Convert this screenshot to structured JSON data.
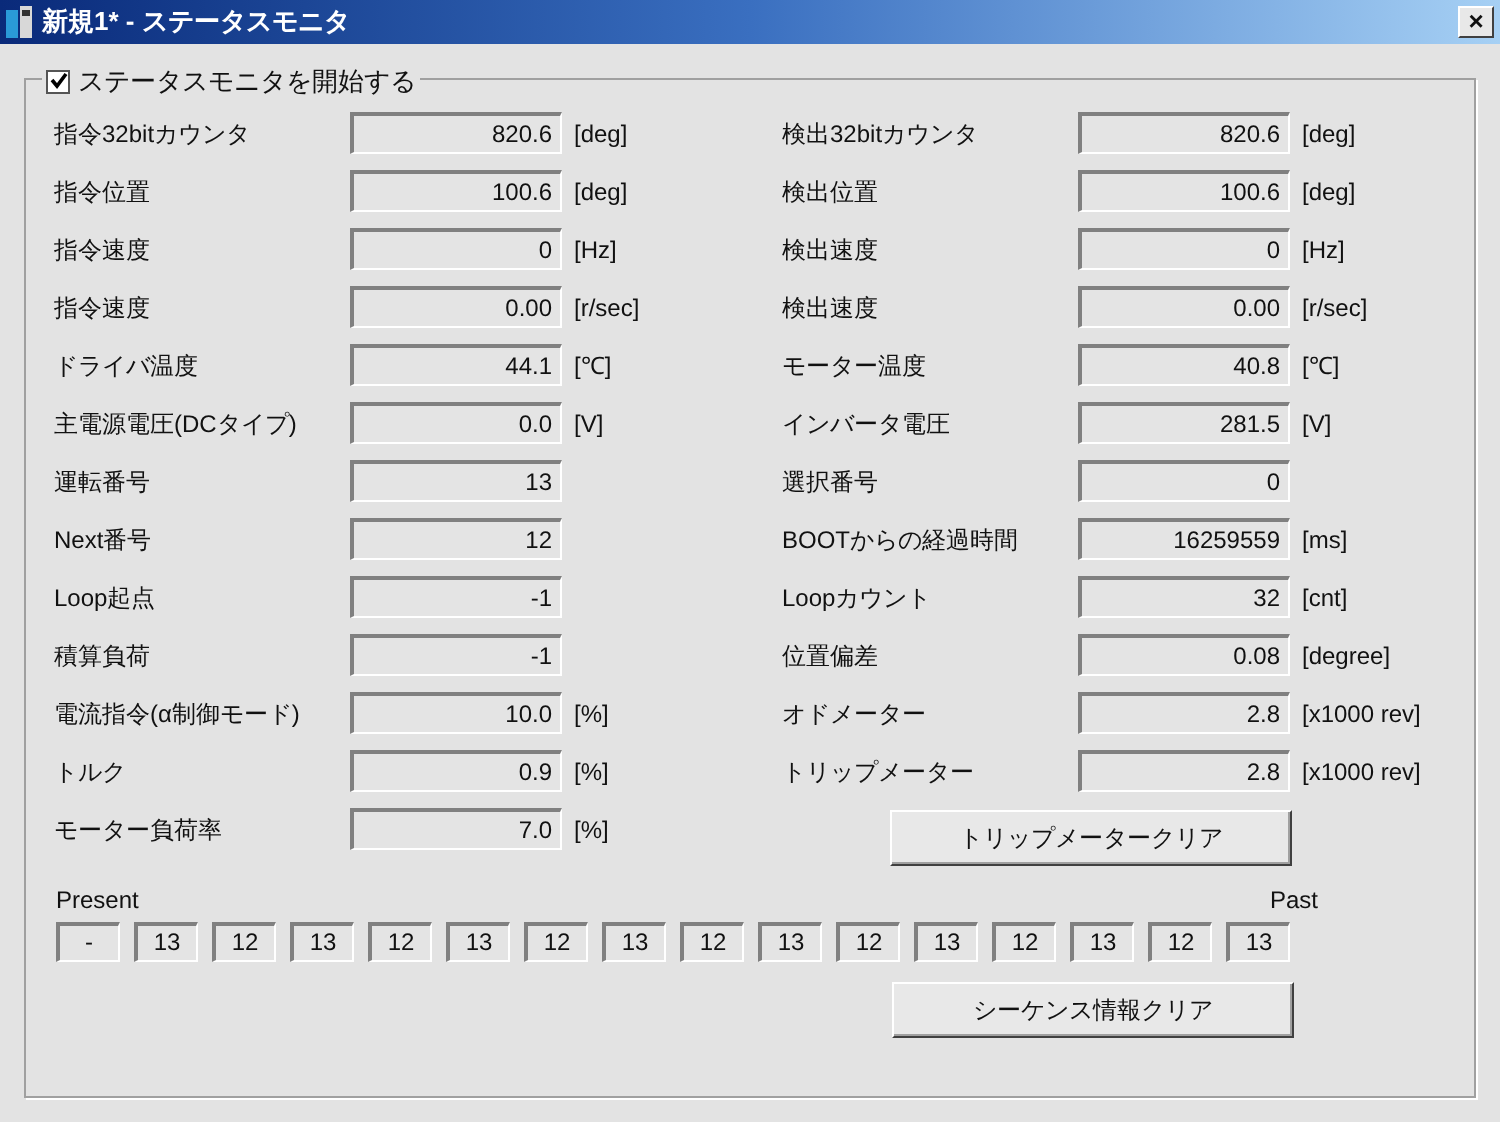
{
  "window": {
    "title": "新規1* - ステータスモニタ",
    "close": "×"
  },
  "monitor": {
    "label": "ステータスモニタを開始する",
    "checked": true
  },
  "left": [
    {
      "label": "指令32bitカウンタ",
      "value": "820.6",
      "unit": "[deg]"
    },
    {
      "label": "指令位置",
      "value": "100.6",
      "unit": "[deg]"
    },
    {
      "label": "指令速度",
      "value": "0",
      "unit": "[Hz]"
    },
    {
      "label": "指令速度",
      "value": "0.00",
      "unit": "[r/sec]"
    },
    {
      "label": "ドライバ温度",
      "value": "44.1",
      "unit": "[℃]"
    },
    {
      "label": "主電源電圧(DCタイプ)",
      "value": "0.0",
      "unit": "[V]"
    },
    {
      "label": "運転番号",
      "value": "13"
    },
    {
      "label": "Next番号",
      "value": "12"
    },
    {
      "label": "Loop起点",
      "value": "-1"
    },
    {
      "label": "積算負荷",
      "value": "-1"
    },
    {
      "label": "電流指令(α制御モード)",
      "value": "10.0",
      "unit": "[%]"
    },
    {
      "label": "トルク",
      "value": "0.9",
      "unit": "[%]"
    },
    {
      "label": "モーター負荷率",
      "value": "7.0",
      "unit": "[%]"
    }
  ],
  "right": [
    {
      "label": "検出32bitカウンタ",
      "value": "820.6",
      "unit": "[deg]"
    },
    {
      "label": "検出位置",
      "value": "100.6",
      "unit": "[deg]"
    },
    {
      "label": "検出速度",
      "value": "0",
      "unit": "[Hz]"
    },
    {
      "label": "検出速度",
      "value": "0.00",
      "unit": "[r/sec]"
    },
    {
      "label": "モーター温度",
      "value": "40.8",
      "unit": "[℃]"
    },
    {
      "label": "インバータ電圧",
      "value": "281.5",
      "unit": "[V]"
    },
    {
      "label": "選択番号",
      "value": "0"
    },
    {
      "label": "BOOTからの経過時間",
      "value": "16259559",
      "unit": "[ms]"
    },
    {
      "label": "Loopカウント",
      "value": "32",
      "unit": "[cnt]"
    },
    {
      "label": "位置偏差",
      "value": "0.08",
      "unit": "[degree]"
    },
    {
      "label": "オドメーター",
      "value": "2.8",
      "unit": "[x1000 rev]"
    },
    {
      "label": "トリップメーター",
      "value": "2.8",
      "unit": "[x1000 rev]"
    }
  ],
  "trip_clear_button": "トリップメータークリア",
  "sequence": {
    "present_label": "Present",
    "past_label": "Past",
    "values": [
      "-",
      "13",
      "12",
      "13",
      "12",
      "13",
      "12",
      "13",
      "12",
      "13",
      "12",
      "13",
      "12",
      "13",
      "12",
      "13"
    ]
  },
  "sequence_clear_button": "シーケンス情報クリア"
}
